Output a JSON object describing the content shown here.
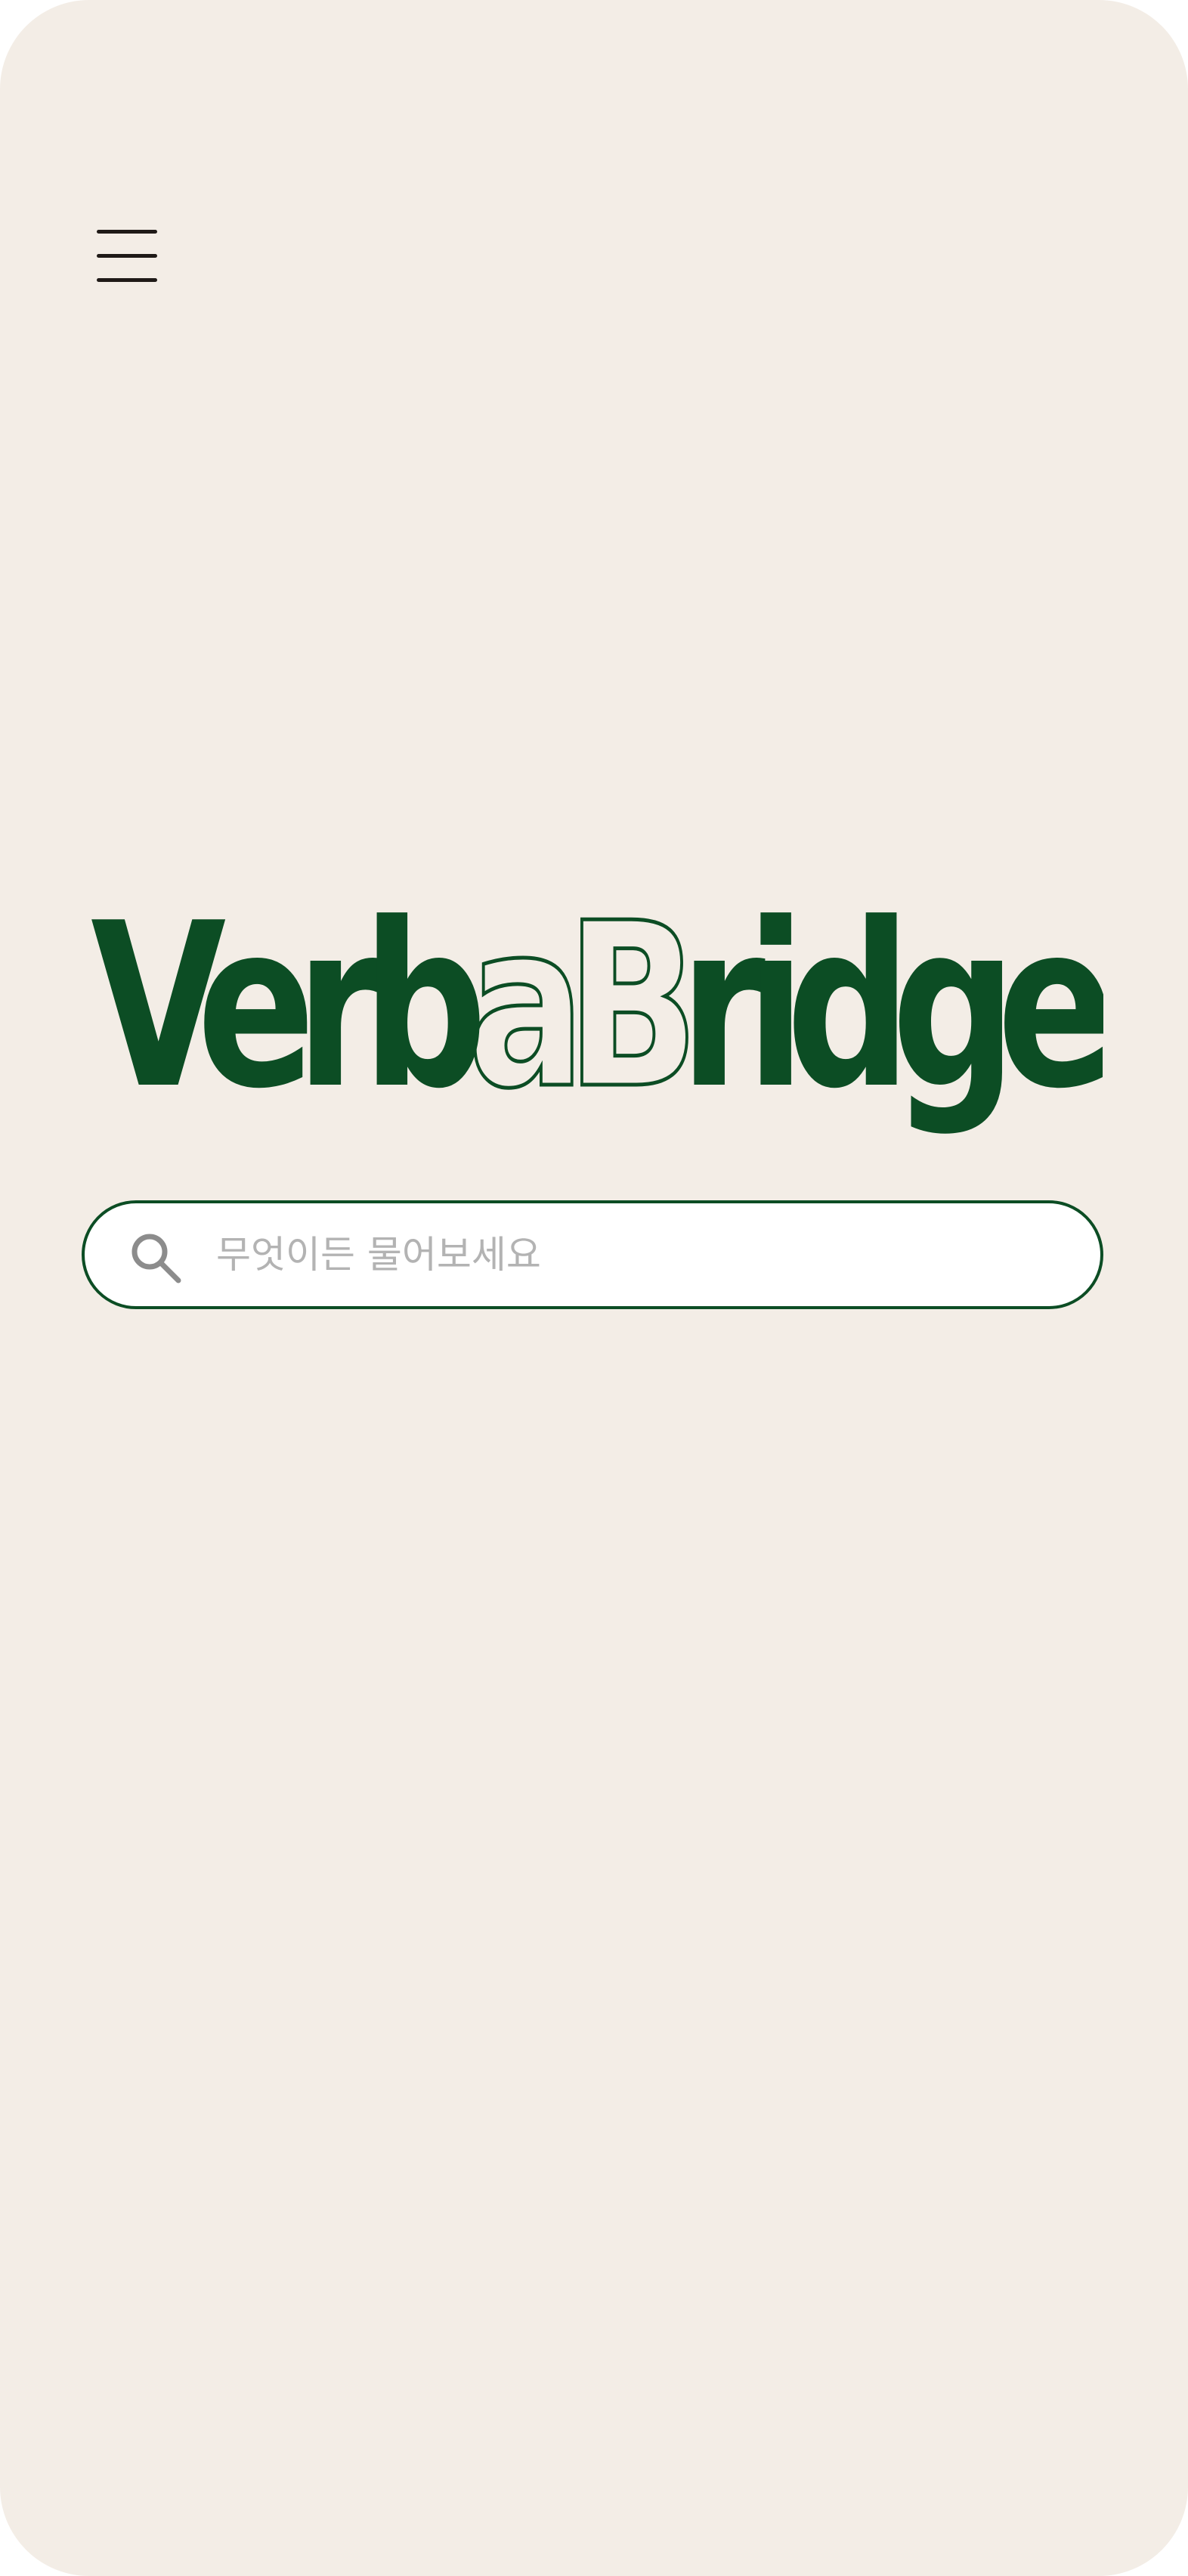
{
  "header": {
    "menu_icon": "hamburger-menu-icon"
  },
  "logo": {
    "part_solid_1": "Verb",
    "part_outline": "aB",
    "part_solid_2": "ridge",
    "text_color": "#0c4d24"
  },
  "search": {
    "icon": "search-icon",
    "placeholder": "무엇이든 물어보세요",
    "value": "",
    "border_color": "#0c4d24"
  },
  "theme": {
    "background": "#f3ede6",
    "accent": "#0c4d24"
  }
}
